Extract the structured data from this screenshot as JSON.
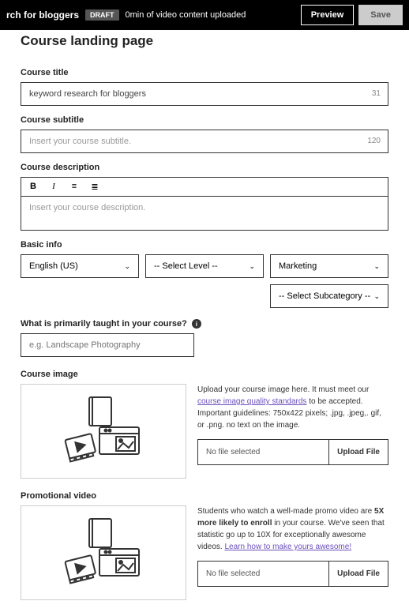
{
  "header": {
    "title": "rch for bloggers",
    "badge": "DRAFT",
    "info": "0min of video content uploaded",
    "preview": "Preview",
    "save": "Save"
  },
  "page": {
    "title": "Course landing page"
  },
  "course_title": {
    "label": "Course title",
    "value": "keyword research for bloggers",
    "counter": "31"
  },
  "subtitle": {
    "label": "Course subtitle",
    "placeholder": "Insert your course subtitle.",
    "counter": "120"
  },
  "description": {
    "label": "Course description",
    "placeholder": "Insert your course description."
  },
  "basic": {
    "label": "Basic info",
    "lang": "English (US)",
    "level": "-- Select Level --",
    "cat": "Marketing",
    "subcat": "-- Select Subcategory --"
  },
  "taught": {
    "label": "What is primarily taught in your course?",
    "placeholder": "e.g. Landscape Photography"
  },
  "image": {
    "label": "Course image",
    "text1": "Upload your course image here. It must meet our ",
    "link": "course image quality standards",
    "text2": " to be accepted. Important guidelines: 750x422 pixels; .jpg, .jpeg,. gif, or .png. no text on the image.",
    "nofile": "No file selected",
    "upload": "Upload File"
  },
  "video": {
    "label": "Promotional video",
    "text1": "Students who watch a well-made promo video are ",
    "bold": "5X more likely to enroll",
    "text2": " in your course. We've seen that statistic go up to 10X for exceptionally awesome videos. ",
    "link": "Learn how to make yours awesome!",
    "nofile": "No file selected",
    "upload": "Upload File"
  }
}
